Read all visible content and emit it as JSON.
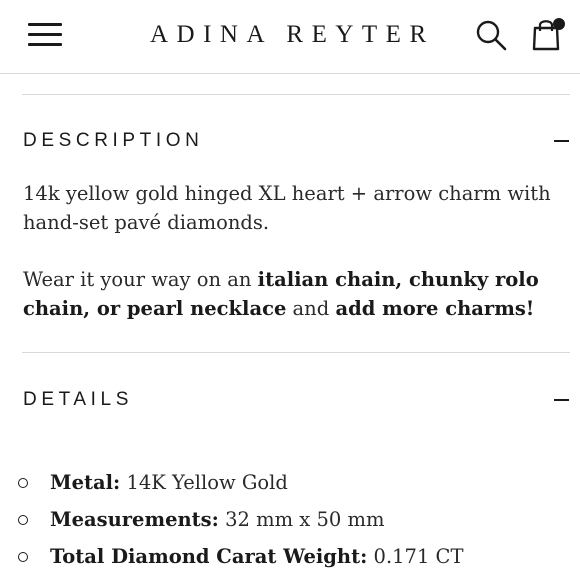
{
  "header": {
    "brand": "ADINA REYTER",
    "icons": [
      "hamburger-menu-icon",
      "search-icon",
      "shopping-bag-icon"
    ]
  },
  "description": {
    "heading": "DESCRIPTION",
    "toggle_symbol": "minus",
    "paragraph1": "14k yellow gold hinged XL heart + arrow charm with hand-set pavé diamonds.",
    "paragraph2": {
      "prefix": "Wear it your way on an ",
      "link1": "italian chain, chunky rolo chain, or pearl necklace",
      "middle": " and ",
      "link2": "add more charms!"
    }
  },
  "details": {
    "heading": "DETAILS",
    "toggle_symbol": "minus",
    "items": [
      {
        "label": "Metal:",
        "value": "14K Yellow Gold"
      },
      {
        "label": "Measurements:",
        "value": "32 mm x 50 mm"
      },
      {
        "label": "Total Diamond Carat Weight:",
        "value": "0.171 CT"
      }
    ]
  },
  "colors": {
    "text": "#1a1a1a",
    "divider": "#d9d9d9",
    "background": "#ffffff",
    "cart_indicator": "#1a1a1a"
  }
}
